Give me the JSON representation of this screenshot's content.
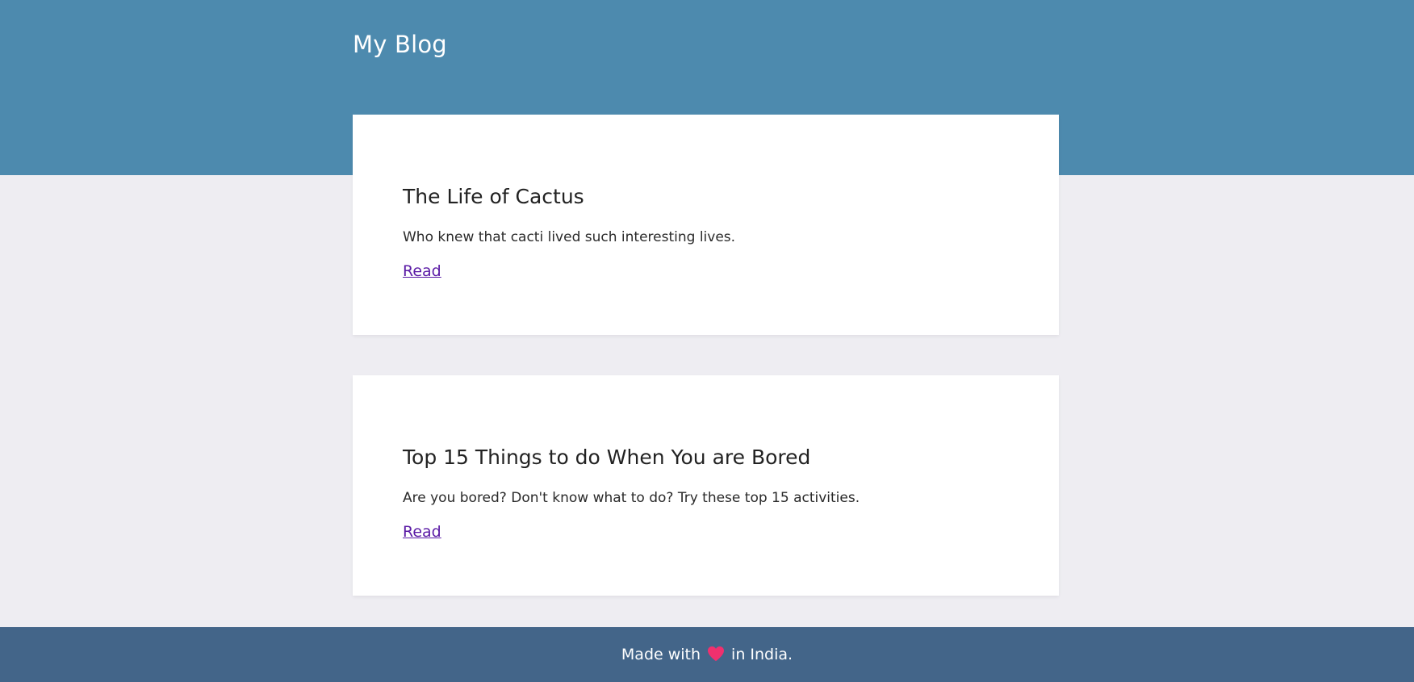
{
  "header": {
    "site_title": "My Blog",
    "background_color": "#4d8aae"
  },
  "posts": [
    {
      "title": "The Life of Cactus",
      "excerpt": "Who knew that cacti lived such interesting lives.",
      "link_label": "Read"
    },
    {
      "title": "Top 15 Things to do When You are Bored",
      "excerpt": "Are you bored? Don't know what to do? Try these top 15 activities.",
      "link_label": "Read"
    }
  ],
  "footer": {
    "text_before": "Made with",
    "icon": "heart-icon",
    "icon_color": "#f0306e",
    "text_after": "in India.",
    "background_color": "#436589"
  }
}
